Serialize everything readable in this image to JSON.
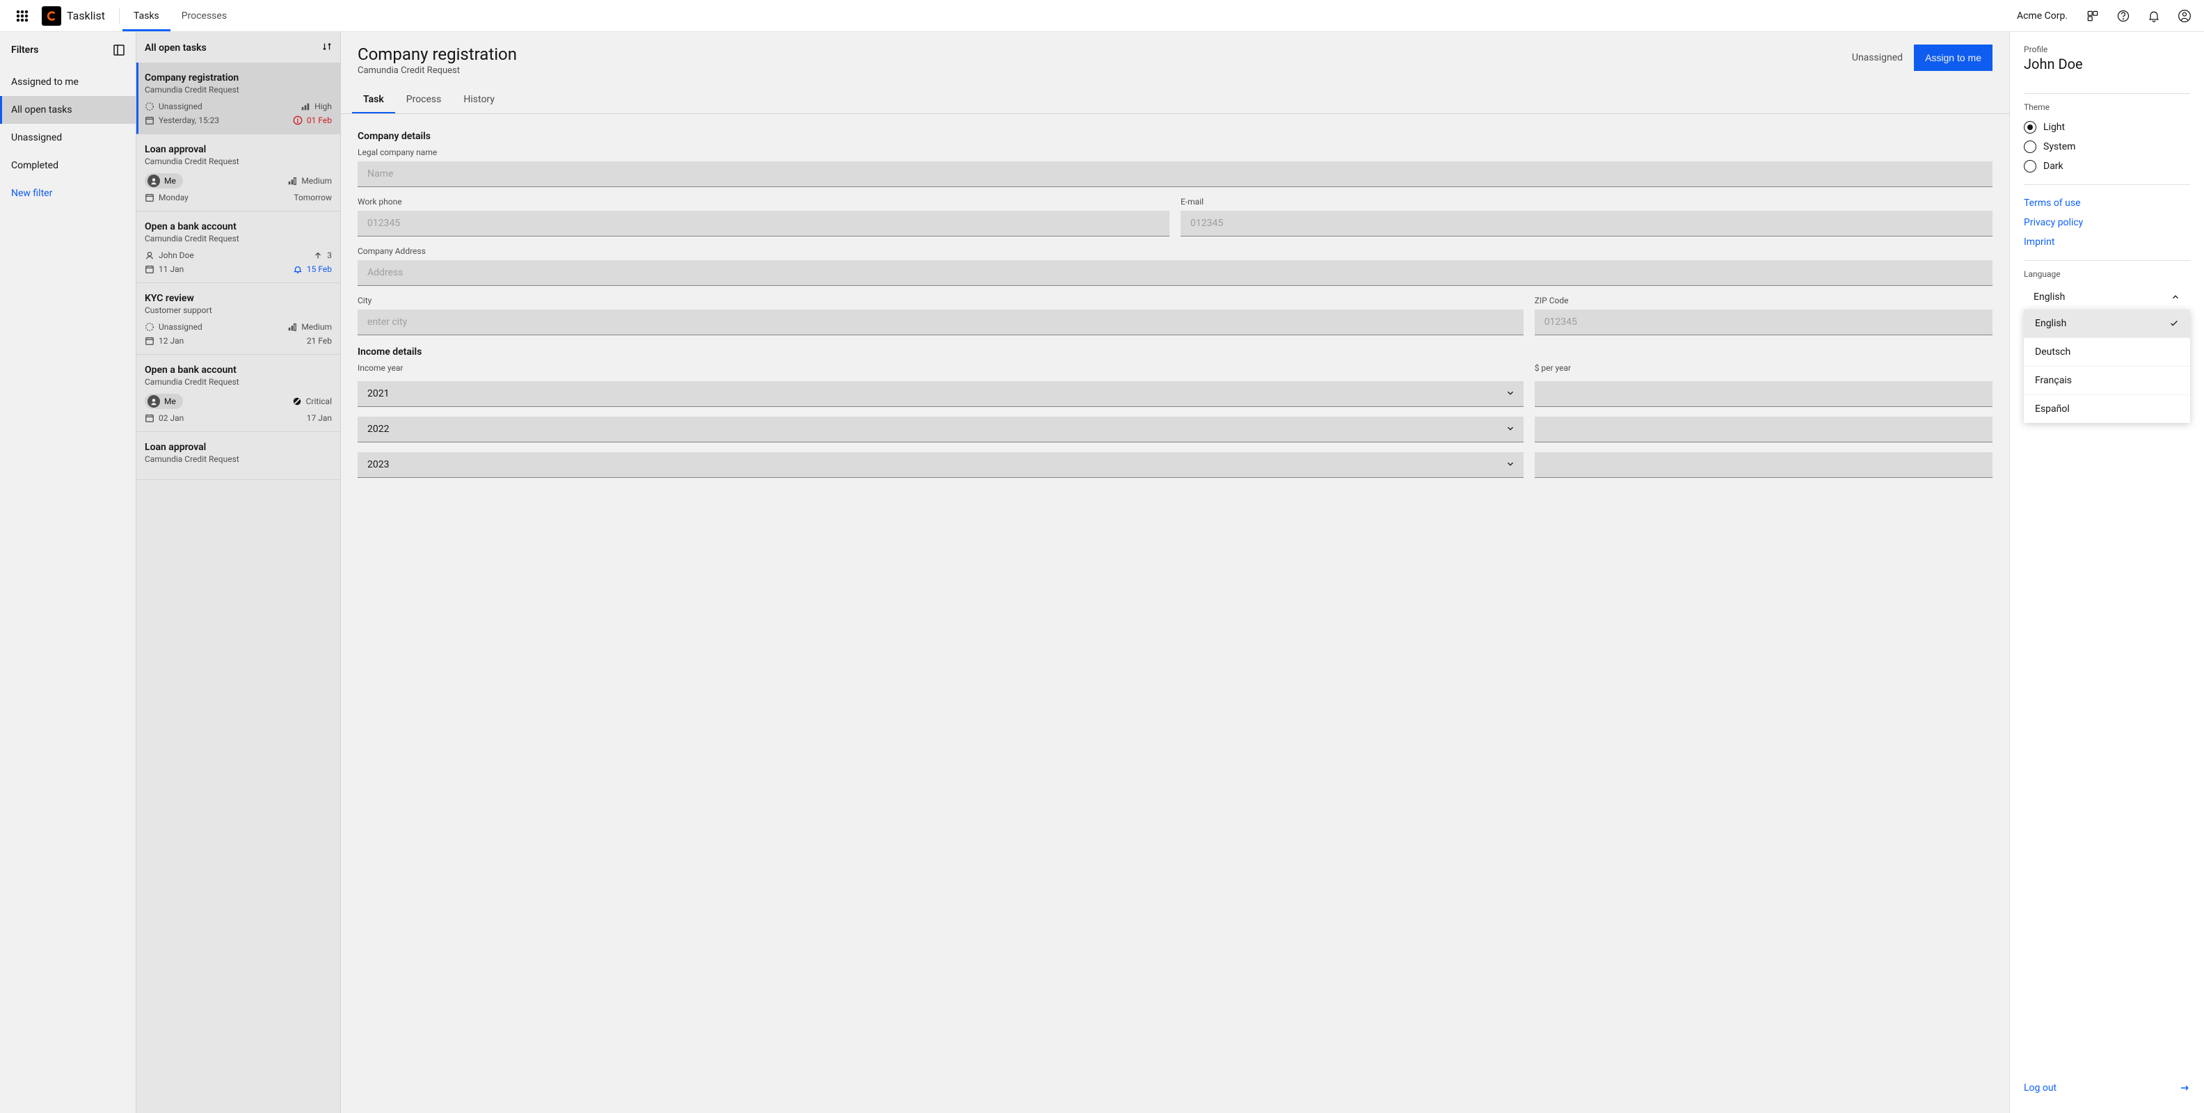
{
  "topbar": {
    "brand": "Tasklist",
    "nav": [
      "Tasks",
      "Processes"
    ],
    "nav_active": 0,
    "org": "Acme Corp."
  },
  "filters": {
    "header": "Filters",
    "items": [
      "Assigned to me",
      "All open tasks",
      "Unassigned",
      "Completed"
    ],
    "active": 1,
    "new_filter": "New filter"
  },
  "tasklist": {
    "header": "All open tasks",
    "items": [
      {
        "title": "Company registration",
        "process": "Camundia Credit Request",
        "assignee_type": "unassigned",
        "assignee": "Unassigned",
        "priority": "High",
        "priority_level": "high",
        "date_left": "Yesterday, 15:23",
        "date_right": "01 Feb",
        "due_state": "overdue",
        "selected": true
      },
      {
        "title": "Loan approval",
        "process": "Camundia Credit Request",
        "assignee_type": "me",
        "assignee": "Me",
        "priority": "Medium",
        "priority_level": "medium",
        "date_left": "Monday",
        "date_right": "Tomorrow",
        "due_state": "normal"
      },
      {
        "title": "Open a bank account",
        "process": "Camundia Credit Request",
        "assignee_type": "user",
        "assignee": "John Doe",
        "priority": "3",
        "priority_level": "up",
        "date_left": "11 Jan",
        "date_right": "15 Feb",
        "due_state": "reminder"
      },
      {
        "title": "KYC review",
        "process": "Customer support",
        "assignee_type": "unassigned",
        "assignee": "Unassigned",
        "priority": "Medium",
        "priority_level": "medium",
        "date_left": "12 Jan",
        "date_right": "21 Feb",
        "due_state": "normal"
      },
      {
        "title": "Open a bank account",
        "process": "Camundia Credit Request",
        "assignee_type": "me",
        "assignee": "Me",
        "priority": "Critical",
        "priority_level": "critical",
        "date_left": "02 Jan",
        "date_right": "17 Jan",
        "due_state": "normal"
      },
      {
        "title": "Loan approval",
        "process": "Camundia Credit Request",
        "assignee_type": "",
        "assignee": "",
        "priority": "",
        "priority_level": "",
        "date_left": "",
        "date_right": "",
        "due_state": ""
      }
    ]
  },
  "detail": {
    "title": "Company registration",
    "subtitle": "Camundia Credit Request",
    "status": "Unassigned",
    "assign_btn": "Assign to me",
    "tabs": [
      "Task",
      "Process",
      "History"
    ],
    "tab_active": 0,
    "form": {
      "company_section": "Company details",
      "legal_name_label": "Legal company name",
      "legal_name_placeholder": "Name",
      "work_phone_label": "Work phone",
      "work_phone_placeholder": "012345",
      "email_label": "E-mail",
      "email_placeholder": "012345",
      "address_label": "Company Address",
      "address_placeholder": "Address",
      "city_label": "City",
      "city_placeholder": "enter city",
      "zip_label": "ZIP Code",
      "zip_placeholder": "012345",
      "income_section": "Income details",
      "income_year_label": "Income year",
      "per_year_label": "$ per year",
      "years": [
        "2021",
        "2022",
        "2023"
      ]
    }
  },
  "profile": {
    "label": "Profile",
    "name": "John Doe",
    "theme_label": "Theme",
    "themes": [
      "Light",
      "System",
      "Dark"
    ],
    "theme_selected": 0,
    "links": [
      "Terms of use",
      "Privacy policy",
      "Imprint"
    ],
    "language_label": "Language",
    "language_current": "English",
    "language_options": [
      "English",
      "Deutsch",
      "Français",
      "Español"
    ],
    "language_selected": 0,
    "logout": "Log out"
  }
}
